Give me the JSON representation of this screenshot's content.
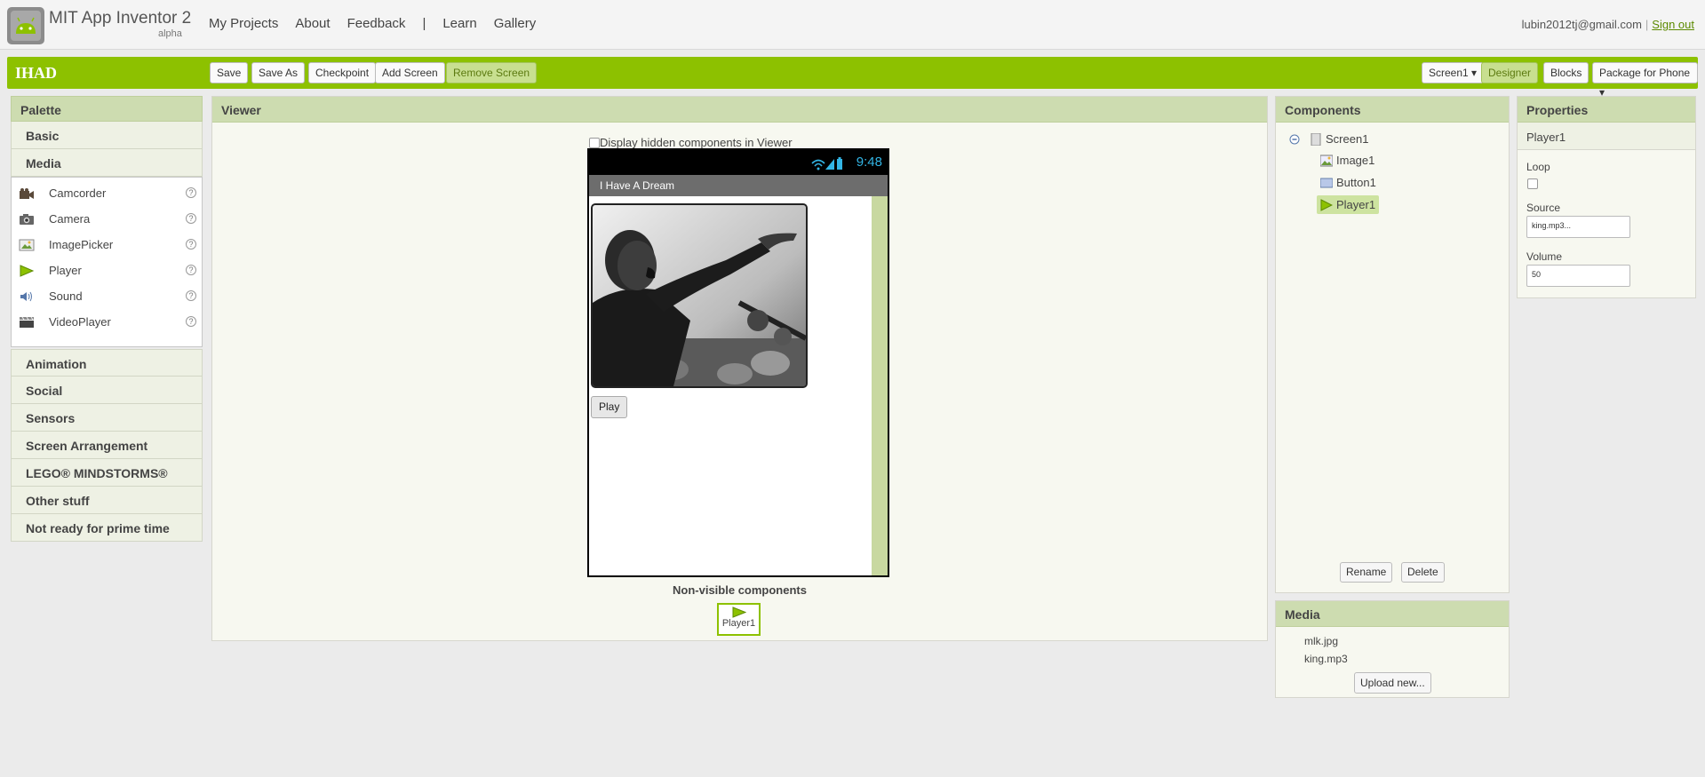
{
  "app": {
    "title": "MIT App Inventor 2",
    "subtitle": "alpha"
  },
  "topnav": {
    "my_projects": "My Projects",
    "about": "About",
    "feedback": "Feedback",
    "separator": "|",
    "learn": "Learn",
    "gallery": "Gallery"
  },
  "user": {
    "email": "lubin2012tj@gmail.com",
    "separator": "|",
    "sign_out": "Sign out"
  },
  "project": {
    "name": "IHAD",
    "buttons": {
      "save": "Save",
      "save_as": "Save As",
      "checkpoint": "Checkpoint",
      "add_screen": "Add Screen",
      "remove_screen": "Remove Screen"
    },
    "screen_select": "Screen1 ▾",
    "designer": "Designer",
    "blocks": "Blocks",
    "package": "Package for Phone ▾"
  },
  "palette": {
    "header": "Palette",
    "categories_top": [
      "Basic",
      "Media"
    ],
    "media_items": [
      {
        "label": "Camcorder",
        "icon": "camcorder-icon"
      },
      {
        "label": "Camera",
        "icon": "camera-icon"
      },
      {
        "label": "ImagePicker",
        "icon": "imagepicker-icon"
      },
      {
        "label": "Player",
        "icon": "player-icon"
      },
      {
        "label": "Sound",
        "icon": "sound-icon"
      },
      {
        "label": "VideoPlayer",
        "icon": "videoplayer-icon"
      }
    ],
    "categories_bottom": [
      "Animation",
      "Social",
      "Sensors",
      "Screen Arrangement",
      "LEGO® MINDSTORMS®",
      "Other stuff",
      "Not ready for prime time"
    ]
  },
  "viewer": {
    "header": "Viewer",
    "hidden_label": "Display hidden components in Viewer",
    "status_time": "9:48",
    "screen_title": "I Have A Dream",
    "play_button": "Play",
    "nonvisible_title": "Non-visible components",
    "nonvisible_item": "Player1"
  },
  "components": {
    "header": "Components",
    "tree": {
      "screen": "Screen1",
      "image": "Image1",
      "button": "Button1",
      "player": "Player1"
    },
    "rename": "Rename",
    "delete": "Delete"
  },
  "media": {
    "header": "Media",
    "files": [
      "mlk.jpg",
      "king.mp3"
    ],
    "upload": "Upload new..."
  },
  "properties": {
    "header": "Properties",
    "component": "Player1",
    "loop_label": "Loop",
    "loop_checked": false,
    "source_label": "Source",
    "source_value": "king.mp3...",
    "volume_label": "Volume",
    "volume_value": "50"
  },
  "colors": {
    "accent_green": "#8dc100",
    "panel_header": "#cddcb0",
    "status_time": "#33b5e5"
  }
}
